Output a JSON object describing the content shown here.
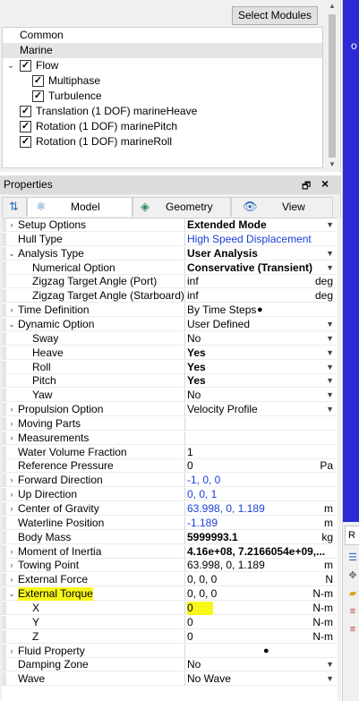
{
  "modules": {
    "select_button": "Select Modules",
    "items": [
      {
        "label": "Common",
        "checked": false,
        "expander": false,
        "selected": false
      },
      {
        "label": "Marine",
        "checked": false,
        "expander": false,
        "selected": true
      },
      {
        "label": "Flow",
        "checked": true,
        "expander": true,
        "selected": false
      },
      {
        "label": "Multiphase",
        "checked": true,
        "expander": false,
        "selected": false
      },
      {
        "label": "Turbulence",
        "checked": true,
        "expander": false,
        "selected": false
      },
      {
        "label": "Translation (1 DOF) marineHeave",
        "checked": true,
        "expander": false,
        "selected": false
      },
      {
        "label": "Rotation (1 DOF) marinePitch",
        "checked": true,
        "expander": false,
        "selected": false
      },
      {
        "label": "Rotation (1 DOF) marineRoll",
        "checked": true,
        "expander": false,
        "selected": false
      }
    ]
  },
  "properties": {
    "title": "Properties",
    "tabs": [
      {
        "label": "Model",
        "icon": "model-icon",
        "active": true
      },
      {
        "label": "Geometry",
        "icon": "geometry-icon",
        "active": false
      },
      {
        "label": "View",
        "icon": "view-icon",
        "active": false
      }
    ],
    "rows": [
      {
        "name": "Setup Options",
        "value": "Extended Mode",
        "style": "bold",
        "unit": "",
        "dropdown": true,
        "expander": "collapsed"
      },
      {
        "name": "Hull Type",
        "value": "High Speed Displacement",
        "style": "link",
        "unit": "",
        "dropdown": false,
        "expander": "none",
        "selected": true
      },
      {
        "name": "Analysis Type",
        "value": "User Analysis",
        "style": "bold",
        "unit": "",
        "dropdown": true,
        "expander": "expanded"
      },
      {
        "name": "Numerical Option",
        "value": "Conservative (Transient)",
        "style": "bold",
        "unit": "",
        "dropdown": true,
        "expander": "none",
        "indent": 1,
        "selected": true
      },
      {
        "name": "Zigzag Target Angle (Port)",
        "value": "inf",
        "style": "",
        "unit": "deg",
        "dropdown": false,
        "expander": "none",
        "indent": 1
      },
      {
        "name": "Zigzag Target Angle (Starboard)",
        "value": "inf",
        "style": "",
        "unit": "deg",
        "dropdown": false,
        "expander": "none",
        "indent": 1,
        "selected": true
      },
      {
        "name": "Time Definition",
        "value": "By Time Steps",
        "style": "",
        "unit": "",
        "dropdown": false,
        "expander": "collapsed",
        "dot": true
      },
      {
        "name": "Dynamic Option",
        "value": "User Defined",
        "style": "",
        "unit": "",
        "dropdown": true,
        "expander": "expanded"
      },
      {
        "name": "Sway",
        "value": "No",
        "style": "",
        "unit": "",
        "dropdown": true,
        "expander": "none",
        "indent": 1
      },
      {
        "name": "Heave",
        "value": "Yes",
        "style": "bold",
        "unit": "",
        "dropdown": true,
        "expander": "none",
        "indent": 1
      },
      {
        "name": "Roll",
        "value": "Yes",
        "style": "bold",
        "unit": "",
        "dropdown": true,
        "expander": "none",
        "indent": 1
      },
      {
        "name": "Pitch",
        "value": "Yes",
        "style": "bold",
        "unit": "",
        "dropdown": true,
        "expander": "none",
        "indent": 1
      },
      {
        "name": "Yaw",
        "value": "No",
        "style": "",
        "unit": "",
        "dropdown": true,
        "expander": "none",
        "indent": 1
      },
      {
        "name": "Propulsion Option",
        "value": "Velocity Profile",
        "style": "",
        "unit": "",
        "dropdown": true,
        "expander": "collapsed"
      },
      {
        "name": "Moving Parts",
        "value": "",
        "style": "",
        "unit": "",
        "dropdown": false,
        "expander": "collapsed"
      },
      {
        "name": "Measurements",
        "value": "",
        "style": "",
        "unit": "",
        "dropdown": false,
        "expander": "collapsed"
      },
      {
        "name": "Water Volume Fraction",
        "value": "1",
        "style": "",
        "unit": "",
        "dropdown": false,
        "expander": "none"
      },
      {
        "name": "Reference Pressure",
        "value": "0",
        "style": "",
        "unit": "Pa",
        "dropdown": false,
        "expander": "none",
        "selected": true
      },
      {
        "name": "Forward Direction",
        "value": "-1, 0, 0",
        "style": "link",
        "unit": "",
        "dropdown": false,
        "expander": "collapsed"
      },
      {
        "name": "Up Direction",
        "value": "0, 0, 1",
        "style": "link",
        "unit": "",
        "dropdown": false,
        "expander": "collapsed"
      },
      {
        "name": "Center of Gravity",
        "value": "63.998, 0, 1.189",
        "style": "link",
        "unit": "m",
        "dropdown": false,
        "expander": "collapsed"
      },
      {
        "name": "Waterline Position",
        "value": "-1.189",
        "style": "link",
        "unit": "m",
        "dropdown": false,
        "expander": "none",
        "selected": true
      },
      {
        "name": "Body Mass",
        "value": "5999993.1",
        "style": "bold",
        "unit": "kg",
        "dropdown": false,
        "expander": "none"
      },
      {
        "name": "Moment of Inertia",
        "value": "4.16e+08, 7.2166054e+09,...",
        "style": "bold",
        "unit": "",
        "dropdown": false,
        "expander": "collapsed",
        "selected": true
      },
      {
        "name": "Towing Point",
        "value": "63.998, 0, 1.189",
        "style": "",
        "unit": "m",
        "dropdown": false,
        "expander": "collapsed"
      },
      {
        "name": "External Force",
        "value": "0, 0, 0",
        "style": "",
        "unit": "N",
        "dropdown": false,
        "expander": "collapsed"
      },
      {
        "name": "External Torque",
        "value": "0, 0, 0",
        "style": "",
        "unit": "N-m",
        "dropdown": false,
        "expander": "expanded",
        "highlight": "name"
      },
      {
        "name": "X",
        "value": "0",
        "style": "",
        "unit": "N-m",
        "dropdown": false,
        "expander": "none",
        "indent": 1,
        "highlight": "value",
        "selected": true
      },
      {
        "name": "Y",
        "value": "0",
        "style": "",
        "unit": "N-m",
        "dropdown": false,
        "expander": "none",
        "indent": 1
      },
      {
        "name": "Z",
        "value": "0",
        "style": "",
        "unit": "N-m",
        "dropdown": false,
        "expander": "none",
        "indent": 1
      },
      {
        "name": "Fluid Property",
        "value": "",
        "style": "",
        "unit": "",
        "dropdown": false,
        "expander": "collapsed",
        "dot": true
      },
      {
        "name": "Damping Zone",
        "value": "No",
        "style": "",
        "unit": "",
        "dropdown": true,
        "expander": "none"
      },
      {
        "name": "Wave",
        "value": "No Wave",
        "style": "",
        "unit": "",
        "dropdown": true,
        "expander": "none"
      }
    ]
  },
  "side_panel": {
    "tab_label": "R"
  },
  "colors": {
    "viewport": "#2b2bd6",
    "link": "#1a3fd8",
    "highlight": "#f7f71a"
  }
}
